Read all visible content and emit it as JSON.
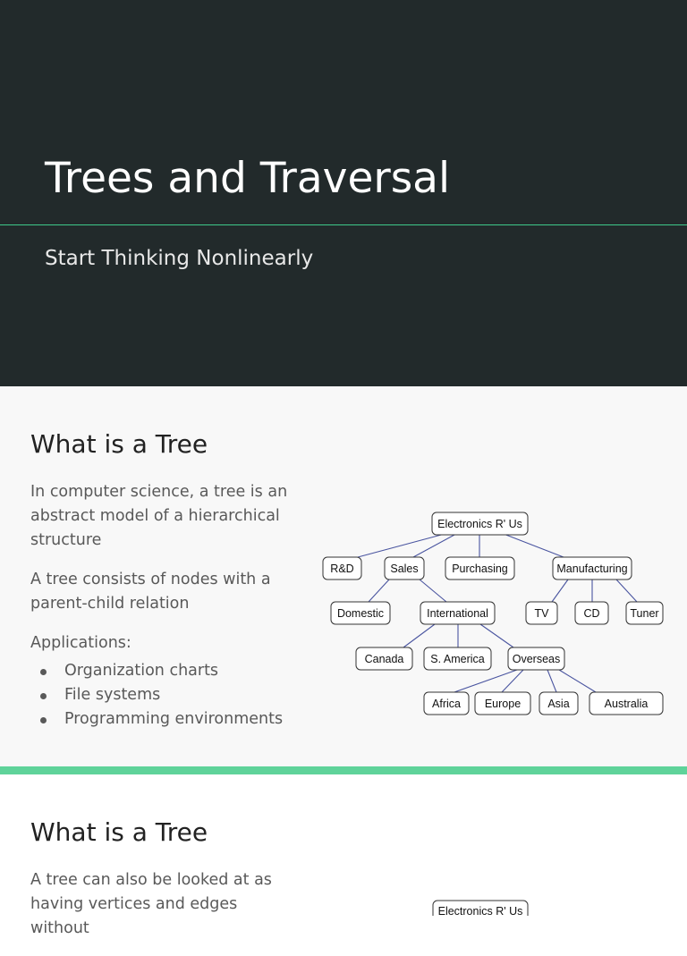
{
  "slide1": {
    "title": "Trees and Traversal",
    "subtitle": "Start Thinking Nonlinearly"
  },
  "slide2": {
    "heading": "What is a Tree",
    "paragraphs": [
      "In computer science, a tree is an abstract model of a hierarchical structure",
      "A tree consists of nodes with a parent-child relation",
      "Applications:"
    ],
    "bullets": [
      "Organization charts",
      "File systems",
      "Programming environments"
    ],
    "tree": {
      "nodes": [
        "Electronics R' Us",
        "R&D",
        "Sales",
        "Purchasing",
        "Manufacturing",
        "Domestic",
        "International",
        "TV",
        "CD",
        "Tuner",
        "Canada",
        "S. America",
        "Overseas",
        "Africa",
        "Europe",
        "Asia",
        "Australia"
      ]
    }
  },
  "slide3": {
    "heading": "What is a Tree",
    "paragraph": "A tree can also be looked at as having vertices and edges without",
    "tree_root": "Electronics R' Us"
  },
  "colors": {
    "dark_bg": "#222a2b",
    "accent": "#5fd39a",
    "edge": "#4a55a0"
  }
}
